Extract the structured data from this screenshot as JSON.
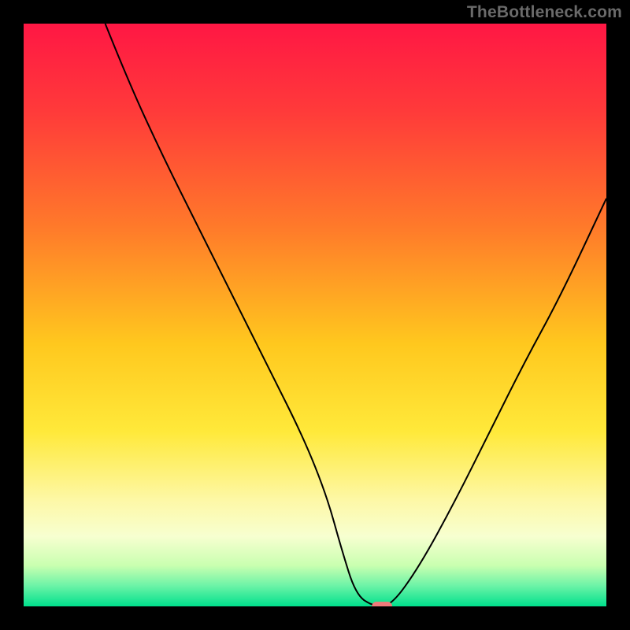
{
  "watermark": "TheBottleneck.com",
  "chart_data": {
    "type": "line",
    "title": "",
    "xlabel": "",
    "ylabel": "",
    "xlim": [
      0,
      100
    ],
    "ylim": [
      0,
      100
    ],
    "grid": false,
    "legend": false,
    "background": {
      "type": "vertical_gradient",
      "stops": [
        {
          "pos": 0.0,
          "color": "#ff1744"
        },
        {
          "pos": 0.15,
          "color": "#ff3a3a"
        },
        {
          "pos": 0.35,
          "color": "#ff7a2a"
        },
        {
          "pos": 0.55,
          "color": "#ffc81e"
        },
        {
          "pos": 0.7,
          "color": "#ffe93a"
        },
        {
          "pos": 0.82,
          "color": "#fdf8a8"
        },
        {
          "pos": 0.88,
          "color": "#f7ffd0"
        },
        {
          "pos": 0.93,
          "color": "#c9ffb0"
        },
        {
          "pos": 0.965,
          "color": "#6bf3a7"
        },
        {
          "pos": 1.0,
          "color": "#00e08c"
        }
      ]
    },
    "series": [
      {
        "name": "bottleneck-curve",
        "color": "#000000",
        "width": 2,
        "x": [
          14,
          18,
          24,
          30,
          36,
          42,
          48,
          52,
          54.5,
          57,
          60,
          63,
          68,
          74,
          80,
          86,
          92,
          100
        ],
        "y": [
          100,
          90,
          77,
          65,
          53,
          41,
          29,
          19,
          10,
          2,
          0,
          0,
          7,
          18,
          30,
          42,
          53,
          70
        ]
      }
    ],
    "marker": {
      "name": "optimum-marker",
      "x": 61.5,
      "y": 0,
      "width_units": 3.5,
      "height_units": 1.6,
      "color": "#ef7a7a"
    }
  }
}
